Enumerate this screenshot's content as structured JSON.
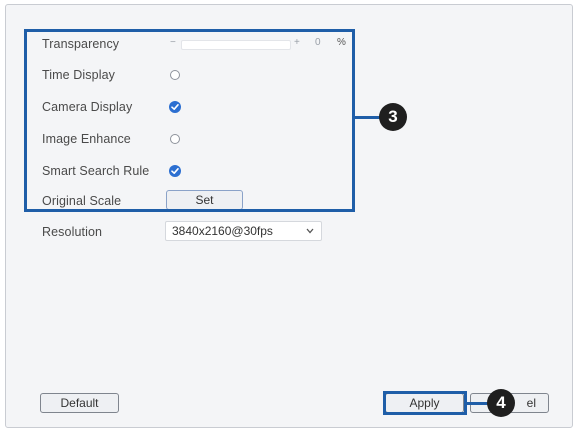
{
  "settings": {
    "transparency": {
      "label": "Transparency",
      "minus": "−",
      "plus": "+",
      "value": "0",
      "unit": "%",
      "level": 0
    },
    "time_display": {
      "label": "Time Display",
      "checked": false
    },
    "camera_display": {
      "label": "Camera Display",
      "checked": true
    },
    "image_enhance": {
      "label": "Image Enhance",
      "checked": false
    },
    "smart_search_rule": {
      "label": "Smart Search Rule",
      "checked": true
    },
    "original_scale": {
      "label": "Original Scale",
      "button": "Set"
    },
    "resolution": {
      "label": "Resolution",
      "value": "3840x2160@30fps"
    }
  },
  "footer": {
    "default_label": "Default",
    "apply_label": "Apply",
    "cancel_label_visible": "el"
  },
  "callouts": {
    "settings_group": "3",
    "apply": "4"
  },
  "colors": {
    "accent": "#2c6fd1",
    "callout": "#1f5ea8"
  }
}
